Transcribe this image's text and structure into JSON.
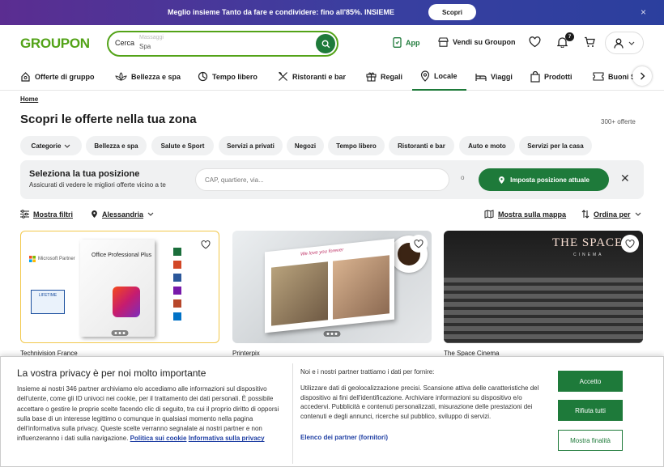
{
  "promo": {
    "text": "Meglio insieme Tanto da fare e condividere: fino all'85%. INSIEME",
    "button": "Scopri",
    "close": "×"
  },
  "header": {
    "logo": "GROUPON",
    "search_label": "Cerca",
    "search_placeholder": "Spa",
    "search_placeholder_faded": "Massaggi",
    "app_label": "App",
    "sell_label": "Vendi su Groupon",
    "notifications_count": "7"
  },
  "categories": [
    {
      "label": "Offerte di gruppo",
      "icon": "group-offers-icon"
    },
    {
      "label": "Bellezza e spa",
      "icon": "lotus-icon"
    },
    {
      "label": "Tempo libero",
      "icon": "leisure-icon"
    },
    {
      "label": "Ristoranti e bar",
      "icon": "cutlery-icon"
    },
    {
      "label": "Regali",
      "icon": "gift-icon"
    },
    {
      "label": "Locale",
      "icon": "pin-icon",
      "active": true
    },
    {
      "label": "Viaggi",
      "icon": "bed-icon"
    },
    {
      "label": "Prodotti",
      "icon": "bag-icon"
    },
    {
      "label": "Buoni S",
      "icon": "ticket-icon"
    }
  ],
  "breadcrumb": "Home",
  "page_title": "Scopri le offerte nella tua zona",
  "offer_count": "300+ offerte",
  "chips": [
    "Categorie",
    "Bellezza e spa",
    "Salute e Sport",
    "Servizi a privati",
    "Negozi",
    "Tempo libero",
    "Ristoranti e bar",
    "Auto e moto",
    "Servizi per la casa"
  ],
  "location": {
    "title": "Seleziona la tua posizione",
    "subtitle": "Assicurati di vedere le migliori offerte vicino a te",
    "input_placeholder": "CAP, quartiere, via...",
    "or": "o",
    "set_button": "Imposta posizione attuale"
  },
  "filters": {
    "show": "Mostra filtri",
    "city": "Alessandria",
    "map": "Mostra sulla mappa",
    "sort": "Ordina per"
  },
  "deals": [
    {
      "vendor": "Technivision France",
      "brand": "Microsoft Partner",
      "product": "Office Professional Plus",
      "badge": "LIFETIME"
    },
    {
      "vendor": "Printerpix",
      "caption": "We love you forever"
    },
    {
      "vendor": "The Space Cinema",
      "brand": "THE SPACE",
      "sub": "CINEMA"
    }
  ],
  "privacy": {
    "title": "La vostra privacy è per noi molto importante",
    "body": "Insieme ai nostri 346 partner archiviamo e/o accediamo alle informazioni sul dispositivo dell'utente, come gli ID univoci nei cookie, per il trattamento dei dati personali. È possibile accettare o gestire le proprie scelte facendo clic di seguito, tra cui il proprio diritto di opporsi sulla base di un interesse legittimo o comunque in qualsiasi momento nella pagina dell'informativa sulla privacy. Queste scelte verranno segnalate ai nostri partner e non influenzeranno i dati sulla navigazione.",
    "link1": "Politica sui cookie",
    "link2": "Informativa sulla privacy",
    "partners_title": "Noi e i nostri partner trattiamo i dati per fornire:",
    "partners_body": "Utilizzare dati di geolocalizzazione precisi. Scansione attiva delle caratteristiche del dispositivo ai fini dell'identificazione. Archiviare informazioni su dispositivo e/o accedervi. Pubblicità e contenuti personalizzati, misurazione delle prestazioni dei contenuti e degli annunci, ricerche sul pubblico, sviluppo di servizi.",
    "partners_link": "Elenco dei partner (fornitori)",
    "accept": "Accetto",
    "reject": "Rifiuta tutti",
    "show_purposes": "Mostra finalità"
  },
  "colors": {
    "brand_green": "#53a318",
    "dark_green": "#1e7a3a",
    "promo_purple": "#5b2d91",
    "link_blue": "#1f3fa3"
  }
}
